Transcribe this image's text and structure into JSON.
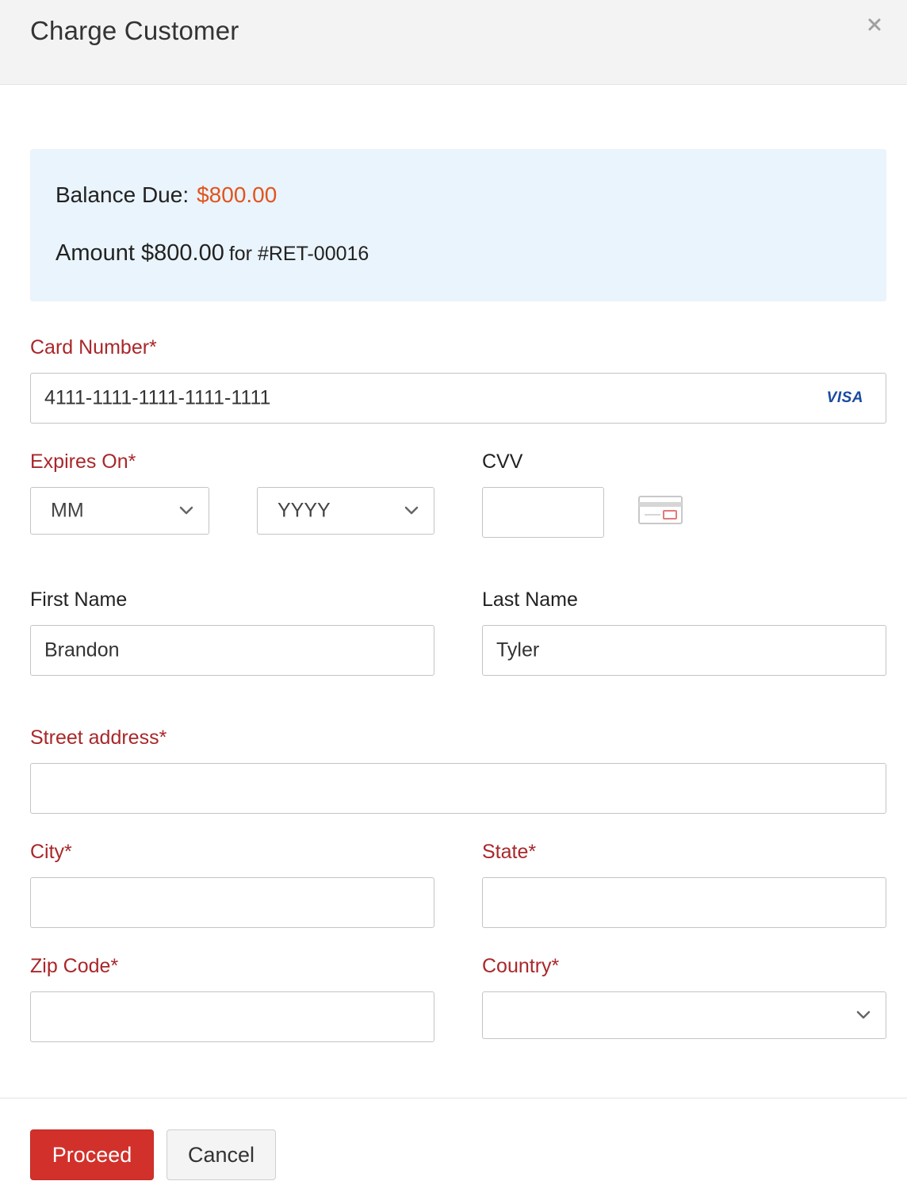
{
  "modal": {
    "title": "Charge Customer",
    "close_icon": "close-icon"
  },
  "summary": {
    "balance_label": "Balance Due:",
    "balance_value": "$800.00",
    "amount_text": "Amount $800.00",
    "amount_for": "for #RET-00016"
  },
  "form": {
    "card_number": {
      "label": "Card Number*",
      "value": "4111-1111-1111-1111-1111",
      "brand": "VISA"
    },
    "expires": {
      "label": "Expires On*",
      "month_value": "MM",
      "year_value": "YYYY"
    },
    "cvv": {
      "label": "CVV",
      "value": "",
      "icon": "card-cvv-icon"
    },
    "first_name": {
      "label": "First Name",
      "value": "Brandon"
    },
    "last_name": {
      "label": "Last Name",
      "value": "Tyler"
    },
    "street": {
      "label": "Street address*",
      "value": ""
    },
    "city": {
      "label": "City*",
      "value": ""
    },
    "state": {
      "label": "State*",
      "value": ""
    },
    "zip": {
      "label": "Zip Code*",
      "value": ""
    },
    "country": {
      "label": "Country*",
      "value": ""
    }
  },
  "footer": {
    "proceed_label": "Proceed",
    "cancel_label": "Cancel"
  },
  "colors": {
    "primary": "#d2312b",
    "required_label": "#a9272a",
    "balance": "#e2541c",
    "info_bg": "#eaf4fc"
  }
}
